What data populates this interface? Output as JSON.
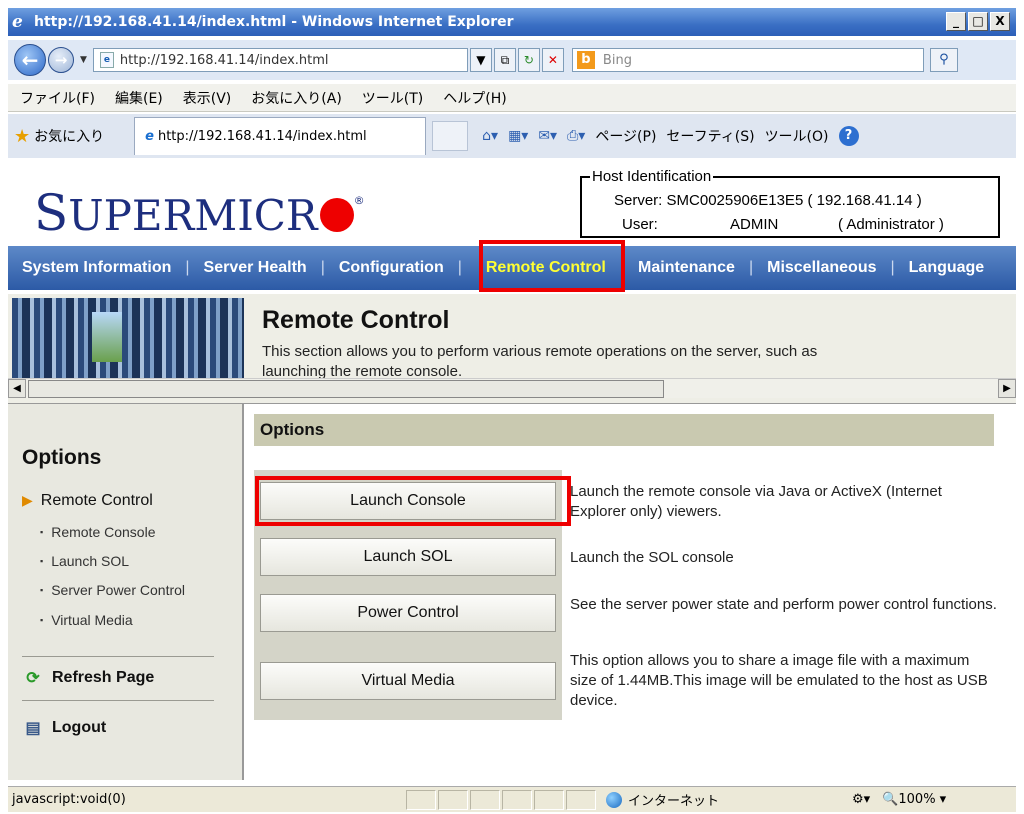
{
  "window": {
    "title": "http://192.168.41.14/index.html - Windows Internet Explorer",
    "controls": [
      "_",
      "□",
      "X"
    ]
  },
  "address": {
    "url": "http://192.168.41.14/index.html",
    "search_placeholder": "Bing"
  },
  "menu": [
    "ファイル(F)",
    "編集(E)",
    "表示(V)",
    "お気に入り(A)",
    "ツール(T)",
    "ヘルプ(H)"
  ],
  "favorites": {
    "label": "お気に入り",
    "tab_title": "http://192.168.41.14/index.html",
    "commands": [
      "ページ(P)",
      "セーフティ(S)",
      "ツール(O)"
    ]
  },
  "header": {
    "logo_first": "S",
    "logo_rest": "UPERMICR",
    "logo_reg": "®",
    "host_legend": "Host Identification",
    "server_label": "Server: SMC0025906E13E5 ( 192.168.41.14 )",
    "user_label": "User:",
    "user_name": "ADMIN",
    "user_role": "( Administrator )"
  },
  "nav": {
    "items": [
      "System Information",
      "Server Health",
      "Configuration",
      "Remote Control",
      "Maintenance",
      "Miscellaneous",
      "Language"
    ]
  },
  "banner": {
    "title": "Remote Control",
    "description": "This section allows you to perform various remote operations on the server, such as launching the remote console."
  },
  "sidebar": {
    "title": "Options",
    "section": "Remote Control",
    "subitems": [
      "Remote Console",
      "Launch SOL",
      "Server Power Control",
      "Virtual Media"
    ],
    "refresh": "Refresh Page",
    "logout": "Logout"
  },
  "main": {
    "header": "Options",
    "options": [
      {
        "button": "Launch Console",
        "desc": "Launch the remote console via Java or ActiveX (Internet Explorer only) viewers."
      },
      {
        "button": "Launch SOL",
        "desc": "Launch the SOL console"
      },
      {
        "button": "Power Control",
        "desc": "See the server power state and perform power control functions."
      },
      {
        "button": "Virtual Media",
        "desc": "This option allows you to share a image file with a maximum size of 1.44MB.This image will be emulated to the host as USB device."
      }
    ]
  },
  "status": {
    "text": "javascript:void(0)",
    "zone": "インターネット",
    "zoom": "100%"
  },
  "colors": {
    "nav_bg": "#2c5aa6",
    "nav_active": "#ffff33",
    "highlight": "#ee0000",
    "logo_blue": "#1d2e7e"
  }
}
